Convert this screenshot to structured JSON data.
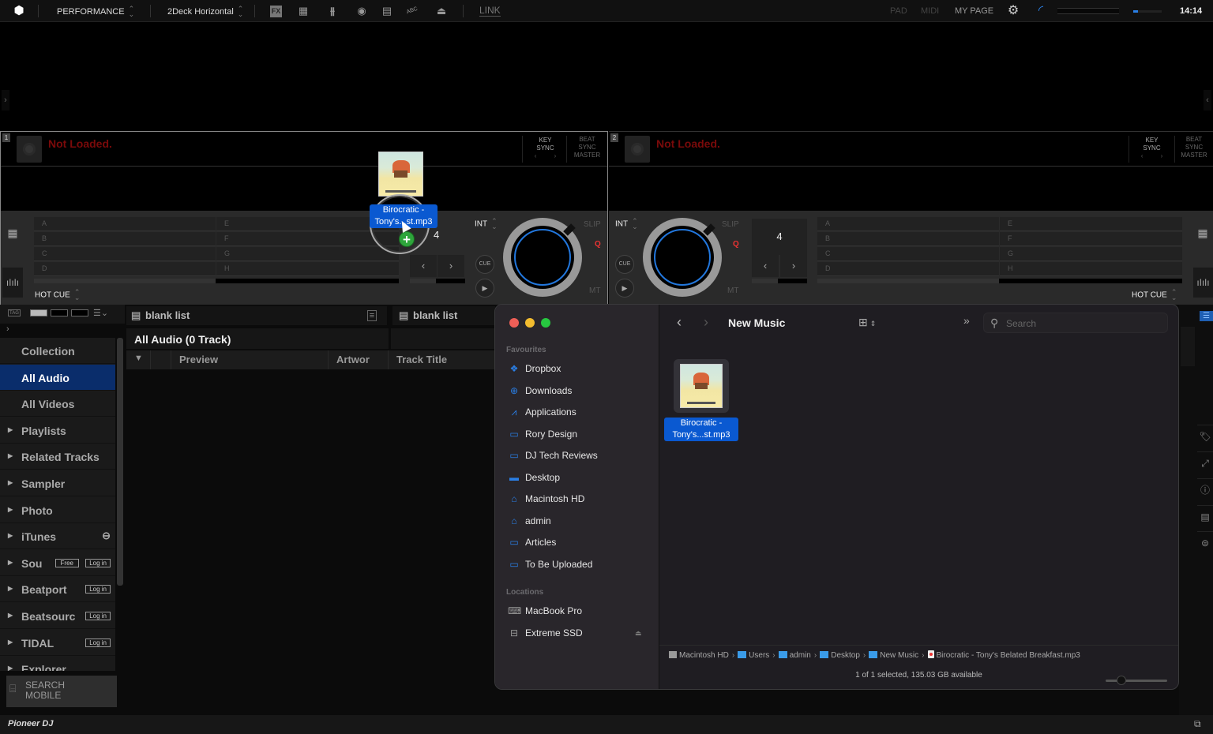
{
  "topbar": {
    "mode": "PERFORMANCE",
    "layout": "2Deck Horizontal",
    "icons": [
      "fx-icon",
      "sampler-grid-icon",
      "mixer-icon",
      "record-icon",
      "video-icon",
      "lyric-abc-icon",
      "camera-icon"
    ],
    "link": "LINK",
    "pad": "PAD",
    "midi": "MIDI",
    "mypage": "MY PAGE",
    "clock": "14:14",
    "master_volume": 0.3
  },
  "decks": [
    {
      "number": "1",
      "status": "Not Loaded.",
      "key_sync": "KEY\nSYNC",
      "beat_sync": [
        "BEAT",
        "SYNC",
        "MASTER"
      ],
      "pads_left": [
        "A",
        "B",
        "C",
        "D"
      ],
      "pads_right": [
        "E",
        "F",
        "G",
        "H"
      ],
      "beat_jump": "4",
      "hot_cue_label": "HOT CUE",
      "int_label": "INT",
      "cue_label": "CUE",
      "slip_label": "SLIP",
      "q_label": "Q",
      "mt_label": "MT"
    },
    {
      "number": "2",
      "status": "Not Loaded.",
      "key_sync": "KEY\nSYNC",
      "beat_sync": [
        "BEAT",
        "SYNC",
        "MASTER"
      ],
      "pads_left": [
        "A",
        "B",
        "C",
        "D"
      ],
      "pads_right": [
        "E",
        "F",
        "G",
        "H"
      ],
      "beat_jump": "4",
      "hot_cue_label": "HOT CUE",
      "int_label": "INT",
      "cue_label": "CUE",
      "slip_label": "SLIP",
      "q_label": "Q",
      "mt_label": "MT"
    }
  ],
  "browser": {
    "tag_label": "TAG",
    "tree": [
      {
        "label": "Collection",
        "arrow": false,
        "selected": false
      },
      {
        "label": "All Audio",
        "arrow": false,
        "selected": true
      },
      {
        "label": "All Videos",
        "arrow": false,
        "selected": false
      },
      {
        "label": "Playlists",
        "arrow": true
      },
      {
        "label": "Related Tracks",
        "arrow": true
      },
      {
        "label": "Sampler",
        "arrow": true
      },
      {
        "label": "Photo",
        "arrow": true
      },
      {
        "label": "iTunes",
        "arrow": true
      },
      {
        "label": "Sou",
        "arrow": true,
        "free": "Free",
        "login": "Log in"
      },
      {
        "label": "Beatport",
        "arrow": true,
        "login": "Log in"
      },
      {
        "label": "Beatsourc",
        "arrow": true,
        "login": "Log in"
      },
      {
        "label": "TIDAL",
        "arrow": true,
        "login": "Log in"
      },
      {
        "label": "Explorer",
        "arrow": true
      }
    ],
    "search_mobile": "SEARCH\nMOBILE",
    "panel1_title": "blank list",
    "panel2_title": "blank list",
    "list_title": "All Audio (0 Track)",
    "columns": [
      "Preview",
      "Artwor",
      "Track Title"
    ],
    "logo": "Pioneer DJ"
  },
  "finder": {
    "title": "New Music",
    "search_placeholder": "Search",
    "favourites_heading": "Favourites",
    "favourites": [
      {
        "label": "Dropbox",
        "icon": "dropbox-icon"
      },
      {
        "label": "Downloads",
        "icon": "download-icon"
      },
      {
        "label": "Applications",
        "icon": "applications-icon"
      },
      {
        "label": "Rory Design",
        "icon": "folder-icon"
      },
      {
        "label": "DJ Tech Reviews",
        "icon": "folder-icon"
      },
      {
        "label": "Desktop",
        "icon": "desktop-icon"
      },
      {
        "label": "Macintosh HD",
        "icon": "drive-icon"
      },
      {
        "label": "admin",
        "icon": "home-icon"
      },
      {
        "label": "Articles",
        "icon": "folder-icon"
      },
      {
        "label": "To Be Uploaded",
        "icon": "folder-icon"
      }
    ],
    "locations_heading": "Locations",
    "locations": [
      {
        "label": "MacBook Pro",
        "icon": "laptop-icon"
      },
      {
        "label": "Extreme SSD",
        "icon": "external-drive-icon"
      }
    ],
    "file": {
      "line1": "Birocratic -",
      "line2": "Tony's...st.mp3"
    },
    "path": [
      "Macintosh HD",
      "Users",
      "admin",
      "Desktop",
      "New Music",
      "Birocratic - Tony's Belated Breakfast.mp3"
    ],
    "status": "1 of 1 selected, 135.03 GB available"
  },
  "drag": {
    "line1": "Birocratic -",
    "line2": "Tony's...st.mp3",
    "plus": "+"
  }
}
